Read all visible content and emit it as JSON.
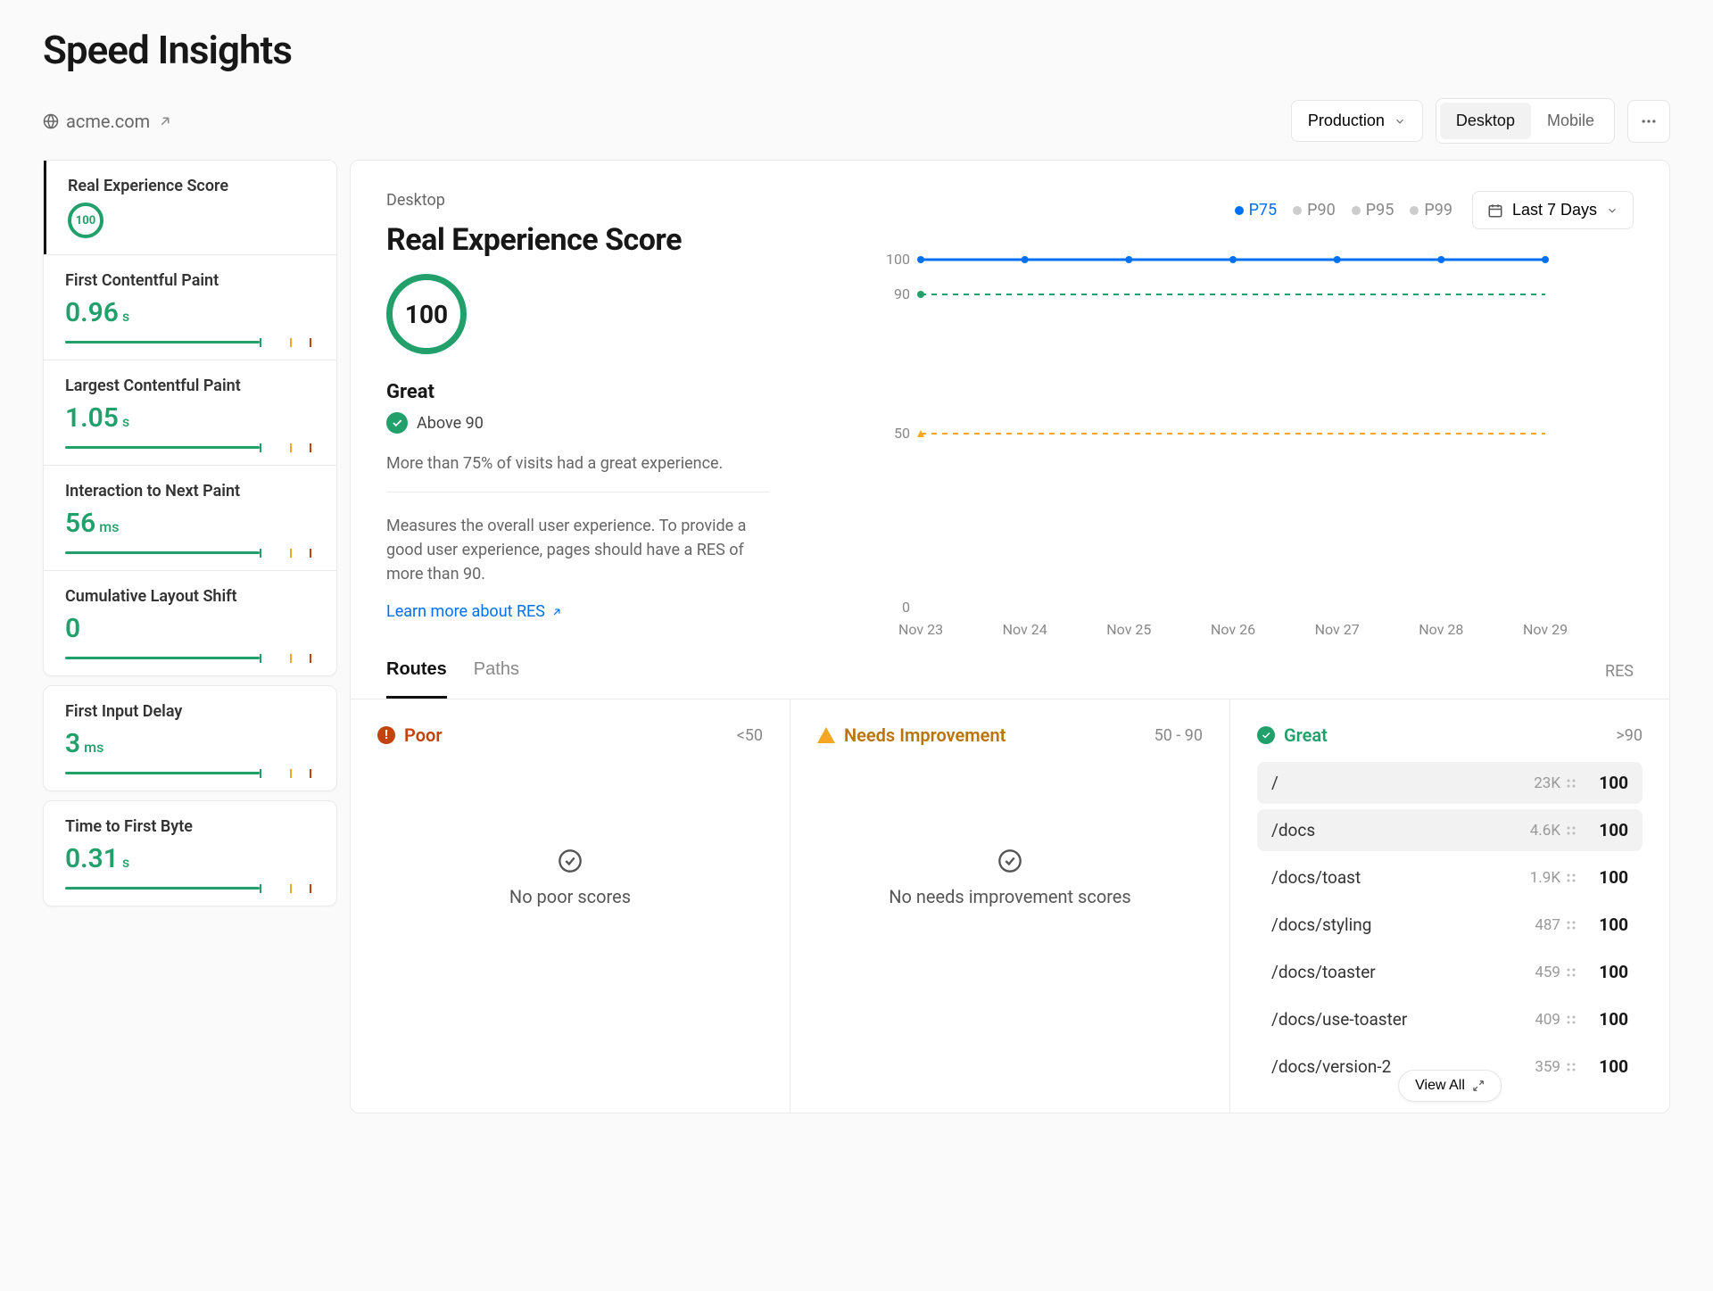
{
  "page_title": "Speed Insights",
  "domain": "acme.com",
  "env_selector": "Production",
  "device_tabs": {
    "desktop": "Desktop",
    "mobile": "Mobile",
    "active": "desktop"
  },
  "metrics": [
    {
      "label": "Real Experience Score",
      "value": "100",
      "unit": "",
      "ring": true,
      "active": true
    },
    {
      "label": "First Contentful Paint",
      "value": "0.96",
      "unit": "s"
    },
    {
      "label": "Largest Contentful Paint",
      "value": "1.05",
      "unit": "s"
    },
    {
      "label": "Interaction to Next Paint",
      "value": "56",
      "unit": "ms"
    },
    {
      "label": "Cumulative Layout Shift",
      "value": "0",
      "unit": ""
    },
    {
      "label": "First Input Delay",
      "value": "3",
      "unit": "ms"
    },
    {
      "label": "Time to First Byte",
      "value": "0.31",
      "unit": "s"
    }
  ],
  "detail": {
    "pretitle": "Desktop",
    "title": "Real Experience Score",
    "score": "100",
    "status_label": "Great",
    "status_sub": "Above 90",
    "desc1": "More than 75% of visits had a great experience.",
    "desc2": "Measures the overall user experience. To provide a good user experience, pages should have a RES of more than 90.",
    "learn": "Learn more about RES"
  },
  "percentiles": {
    "options": [
      "P75",
      "P90",
      "P95",
      "P99"
    ],
    "active": "P75"
  },
  "date_range": "Last 7 Days",
  "chart_data": {
    "type": "line",
    "x": [
      "Nov 23",
      "Nov 24",
      "Nov 25",
      "Nov 26",
      "Nov 27",
      "Nov 28",
      "Nov 29"
    ],
    "series": [
      {
        "name": "P75",
        "values": [
          100,
          100,
          100,
          100,
          100,
          100,
          100
        ],
        "color": "#0070f3"
      }
    ],
    "reference_lines": [
      {
        "value": 90,
        "color": "#22a06b",
        "style": "dashed"
      },
      {
        "value": 50,
        "color": "#f5a623",
        "style": "dashed"
      }
    ],
    "yticks": [
      0,
      50,
      90,
      100
    ],
    "ylim": [
      0,
      100
    ]
  },
  "routing": {
    "tabs": {
      "routes": "Routes",
      "paths": "Paths",
      "metric": "RES"
    },
    "columns": {
      "poor": {
        "title": "Poor",
        "range": "<50",
        "empty": "No poor scores"
      },
      "ni": {
        "title": "Needs Improvement",
        "range": "50 - 90",
        "empty": "No needs improvement scores"
      },
      "great": {
        "title": "Great",
        "range": ">90",
        "empty": ""
      }
    },
    "great_routes": [
      {
        "path": "/",
        "count": "23K",
        "score": "100",
        "sel": true
      },
      {
        "path": "/docs",
        "count": "4.6K",
        "score": "100",
        "sel": true
      },
      {
        "path": "/docs/toast",
        "count": "1.9K",
        "score": "100"
      },
      {
        "path": "/docs/styling",
        "count": "487",
        "score": "100"
      },
      {
        "path": "/docs/toaster",
        "count": "459",
        "score": "100"
      },
      {
        "path": "/docs/use-toaster",
        "count": "409",
        "score": "100"
      },
      {
        "path": "/docs/version-2",
        "count": "359",
        "score": "100"
      }
    ],
    "view_all": "View All"
  }
}
